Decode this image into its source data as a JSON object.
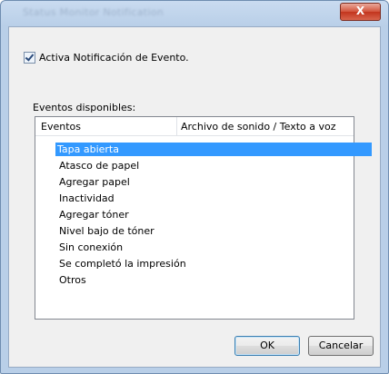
{
  "window": {
    "title": "Status Monitor Notification",
    "close_label": "X"
  },
  "dialog": {
    "checkbox_label": "Activa Notificación de Evento.",
    "checkbox_checked": true,
    "group_label": "Eventos disponibles:",
    "columns": [
      "Eventos",
      "Archivo de sonido / Texto a voz"
    ],
    "events": [
      "Tapa abierta",
      "Atasco de papel",
      "Agregar papel",
      "Inactividad",
      "Agregar tóner",
      "Nivel bajo de tóner",
      "Sin conexión",
      "Se completó la impresión",
      "Otros"
    ],
    "selected_index": 0,
    "ok_label": "OK",
    "cancel_label": "Cancelar"
  },
  "colors": {
    "selection": "#3399ff",
    "close_button": "#c2341d"
  }
}
